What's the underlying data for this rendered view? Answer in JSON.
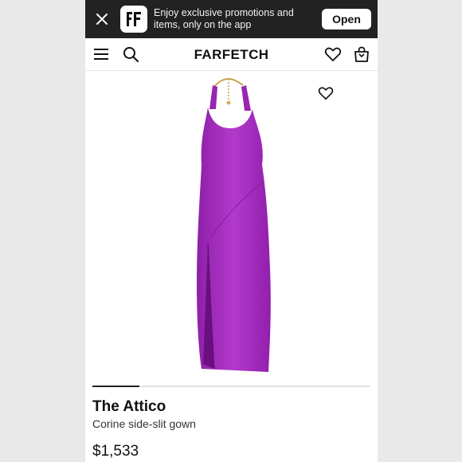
{
  "banner": {
    "promo_text": "Enjoy exclusive promotions and items, only on the app",
    "open_label": "Open"
  },
  "header": {
    "brand": "FARFETCH",
    "icons": [
      "menu-icon",
      "search-icon",
      "wishlist-icon",
      "bag-icon"
    ]
  },
  "product": {
    "designer": "The Attico",
    "name": "Corine side-slit gown",
    "price": "$1,533",
    "image_color": "#a52cbf",
    "gallery_progress": 0.17
  }
}
